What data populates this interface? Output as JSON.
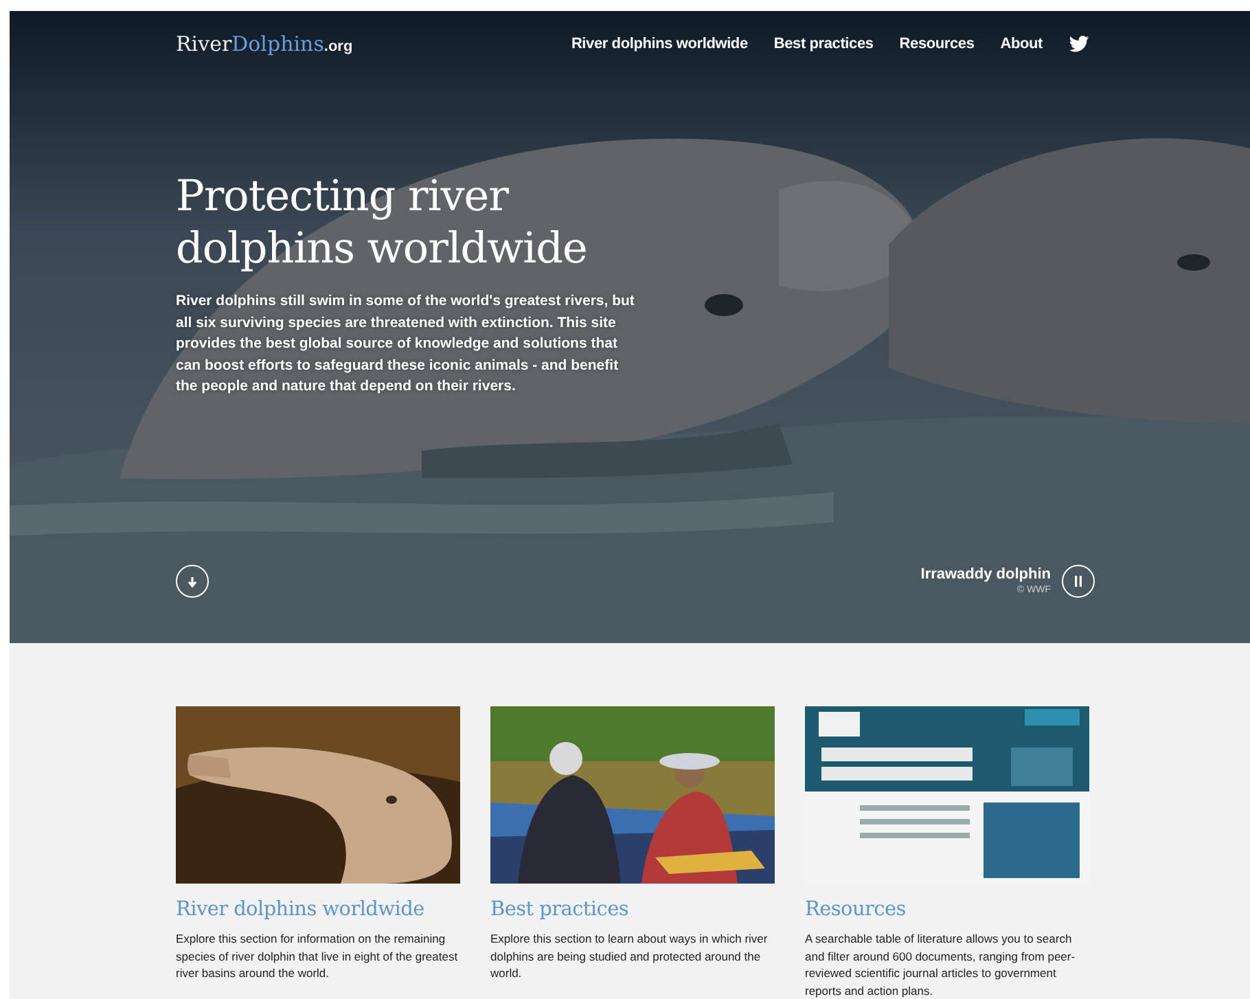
{
  "header": {
    "logo": {
      "first": "River",
      "second": "Dolphins",
      "suffix": ".org"
    },
    "nav": [
      {
        "label": "River dolphins worldwide"
      },
      {
        "label": "Best practices"
      },
      {
        "label": "Resources"
      },
      {
        "label": "About"
      }
    ]
  },
  "hero": {
    "title": "Protecting river dolphins worldwide",
    "text": "River dolphins still swim in some of the world's greatest rivers, but all six surviving species are threatened with extinction. This site provides the best global source of knowledge and solutions that can boost efforts to safeguard these iconic animals - and benefit the people and nature that depend on their rivers.",
    "caption": "Irrawaddy dolphin",
    "credit": "© WWF"
  },
  "cards": [
    {
      "title": "River dolphins worldwide",
      "text": "Explore this section for information on the remaining species of river dolphin that live in eight of the greatest river basins around the world."
    },
    {
      "title": "Best practices",
      "text": "Explore this section to learn about ways in which river dolphins are being studied and protected around the world."
    },
    {
      "title": "Resources",
      "text": "A searchable table of literature allows you to search and filter around 600 documents, ranging from peer-reviewed scientific journal articles to government reports and action plans."
    }
  ]
}
